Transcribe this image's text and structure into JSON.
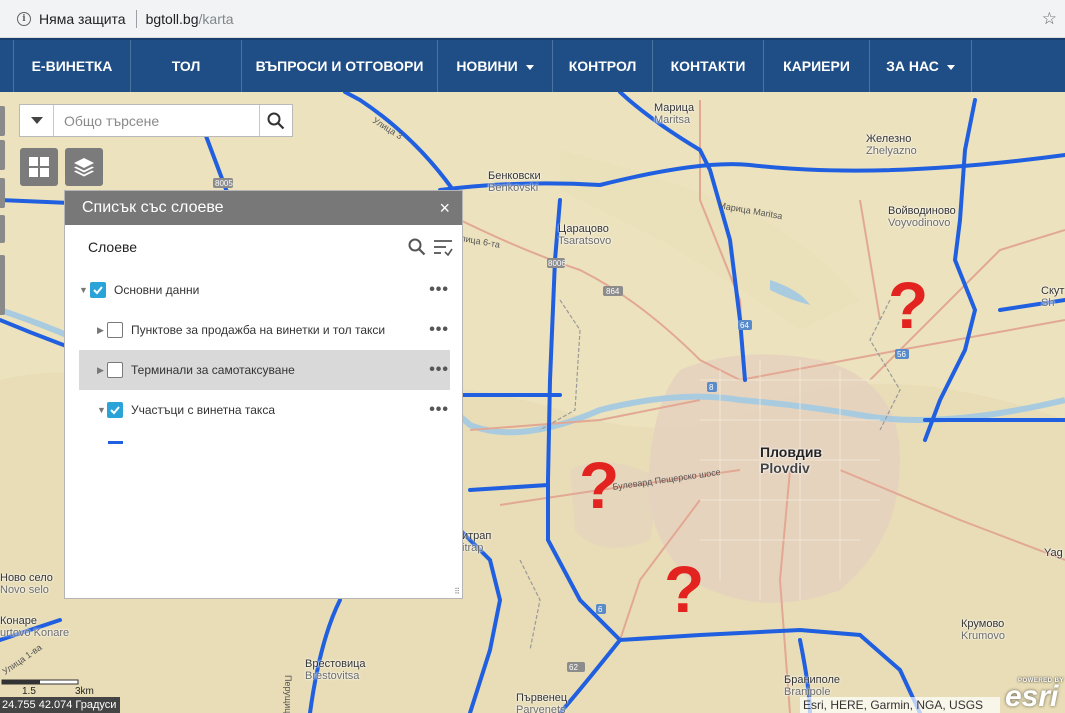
{
  "browser": {
    "security_text": "Няма защита",
    "domain": "bgtoll.bg",
    "path": "/karta",
    "star_icon": "star-icon"
  },
  "nav": {
    "items": [
      {
        "label": "Е-ВИНЕТКА",
        "dropdown": false
      },
      {
        "label": "ТОЛ",
        "dropdown": false
      },
      {
        "label": "ВЪПРОСИ И ОТГОВОРИ",
        "dropdown": false
      },
      {
        "label": "НОВИНИ",
        "dropdown": true
      },
      {
        "label": "КОНТРОЛ",
        "dropdown": false
      },
      {
        "label": "КОНТАКТИ",
        "dropdown": false
      },
      {
        "label": "КАРИЕРИ",
        "dropdown": false
      },
      {
        "label": "ЗА НАС",
        "dropdown": true
      }
    ],
    "background": "#1f4e87"
  },
  "search": {
    "placeholder": "Общо търсене"
  },
  "layer_panel": {
    "title": "Списък със слоеве",
    "close": "×",
    "subheader": "Слоеве",
    "layers": [
      {
        "label": "Основни данни",
        "checked": true,
        "expanded": true,
        "level": 0
      },
      {
        "label": "Пунктове за продажба на винетки и тол такси",
        "checked": false,
        "expanded": false,
        "level": 1
      },
      {
        "label": "Терминали за самотаксуване",
        "checked": false,
        "expanded": false,
        "level": 1,
        "highlighted": true
      },
      {
        "label": "Участъци с винетна такса",
        "checked": true,
        "expanded": true,
        "level": 1
      }
    ],
    "legend_color": "#1f5fe0",
    "more_glyph": "•••"
  },
  "map": {
    "places": [
      {
        "name": "Марица",
        "lat": "Maritsa"
      },
      {
        "name": "Железно",
        "lat": "Zhelyazno"
      },
      {
        "name": "Бенковски",
        "lat": "Benkovski"
      },
      {
        "name": "Царацово",
        "lat": "Tsaratsovo"
      },
      {
        "name": "Войводиново",
        "lat": "Voyvodinovo"
      },
      {
        "name": "Пловдив",
        "lat": "Plovdiv"
      },
      {
        "name": "Ново село",
        "lat": "Novo selo"
      },
      {
        "name": "Конаре",
        "lat": "urtovo Konare"
      },
      {
        "name": "Врестовица",
        "lat": "Brestovitsa"
      },
      {
        "name": "Първенец",
        "lat": "Parvenets"
      },
      {
        "name": "Браниполе",
        "lat": "Branipole"
      },
      {
        "name": "Крумово",
        "lat": "Krumovo"
      },
      {
        "name": "итрап",
        "lat": "itrap"
      },
      {
        "name": "Скут",
        "lat": "Sh"
      },
      {
        "name": "Yag",
        "lat": ""
      }
    ],
    "road_labels": [
      "Улица 3",
      "Улица 6-та",
      "Марица Maritsa",
      "Булевард Пещерско шосе",
      "Улица 1-ва",
      "Перущица"
    ],
    "shields": [
      "8005",
      "8006",
      "864",
      "64",
      "56",
      "8",
      "6",
      "62"
    ],
    "question_mark": "?",
    "road_color": "#1f5fe0",
    "scale_labels": [
      "1.5",
      "3km"
    ],
    "coordinates": "24.755 42.074 Градуси",
    "attribution": "Esri, HERE, Garmin, NGA, USGS",
    "powered_by": "POWERED BY",
    "esri_logo": "esri"
  }
}
